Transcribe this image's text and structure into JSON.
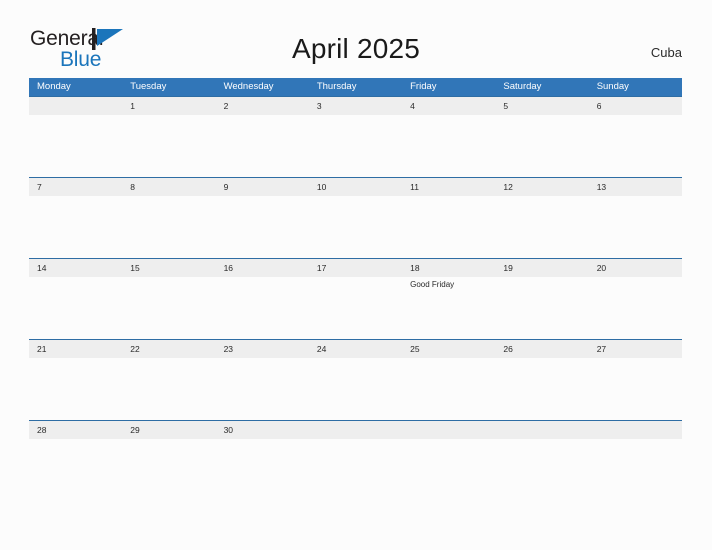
{
  "brand": {
    "word1": "General",
    "word2": "Blue",
    "flag_icon": "blue-flag-triangle",
    "color_dark": "#231f20",
    "color_blue": "#1b75bb"
  },
  "header": {
    "title": "April 2025",
    "country": "Cuba"
  },
  "colors": {
    "header_blue": "#3176b8",
    "row_divider_blue": "#2e6da4",
    "date_band_gray": "#eeeeee",
    "page_background": "#fcfcfc"
  },
  "calendar": {
    "weekday_headers": [
      "Monday",
      "Tuesday",
      "Wednesday",
      "Thursday",
      "Friday",
      "Saturday",
      "Sunday"
    ],
    "weeks": [
      {
        "days": [
          {
            "number": "",
            "events": []
          },
          {
            "number": "1",
            "events": []
          },
          {
            "number": "2",
            "events": []
          },
          {
            "number": "3",
            "events": []
          },
          {
            "number": "4",
            "events": []
          },
          {
            "number": "5",
            "events": []
          },
          {
            "number": "6",
            "events": []
          }
        ]
      },
      {
        "days": [
          {
            "number": "7",
            "events": []
          },
          {
            "number": "8",
            "events": []
          },
          {
            "number": "9",
            "events": []
          },
          {
            "number": "10",
            "events": []
          },
          {
            "number": "11",
            "events": []
          },
          {
            "number": "12",
            "events": []
          },
          {
            "number": "13",
            "events": []
          }
        ]
      },
      {
        "days": [
          {
            "number": "14",
            "events": []
          },
          {
            "number": "15",
            "events": []
          },
          {
            "number": "16",
            "events": []
          },
          {
            "number": "17",
            "events": []
          },
          {
            "number": "18",
            "events": [
              "Good Friday"
            ]
          },
          {
            "number": "19",
            "events": []
          },
          {
            "number": "20",
            "events": []
          }
        ]
      },
      {
        "days": [
          {
            "number": "21",
            "events": []
          },
          {
            "number": "22",
            "events": []
          },
          {
            "number": "23",
            "events": []
          },
          {
            "number": "24",
            "events": []
          },
          {
            "number": "25",
            "events": []
          },
          {
            "number": "26",
            "events": []
          },
          {
            "number": "27",
            "events": []
          }
        ]
      },
      {
        "days": [
          {
            "number": "28",
            "events": []
          },
          {
            "number": "29",
            "events": []
          },
          {
            "number": "30",
            "events": []
          },
          {
            "number": "",
            "events": []
          },
          {
            "number": "",
            "events": []
          },
          {
            "number": "",
            "events": []
          },
          {
            "number": "",
            "events": []
          }
        ]
      }
    ]
  }
}
